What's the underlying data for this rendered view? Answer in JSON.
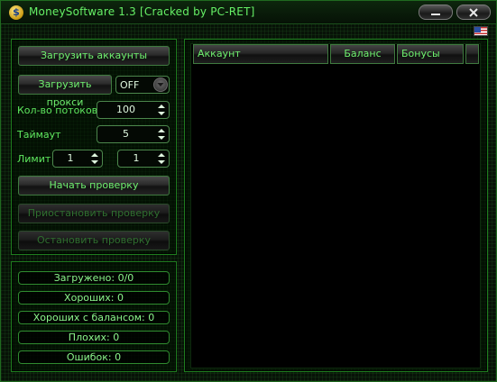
{
  "window": {
    "title": "MoneySoftware 1.3 [Cracked by PC-RET]",
    "app_icon_letter": "$",
    "accent": "#5fe85f",
    "flag": "us-flag-icon"
  },
  "controls": {
    "load_accounts": "Загрузить аккаунты",
    "load_proxy": "Загрузить прокси",
    "proxy_mode": "OFF",
    "threads_label": "Кол-во потоков",
    "threads_value": "100",
    "timeout_label": "Таймаут",
    "timeout_value": "5",
    "limit_label": "Лимит",
    "limit_from": "1",
    "limit_to": "1",
    "start_check": "Начать проверку",
    "pause_check": "Приостановить проверку",
    "stop_check": "Остановить проверку"
  },
  "stats": {
    "loaded": "Загружено: 0/0",
    "good": "Хороших: 0",
    "good_balance": "Хороших с балансом: 0",
    "bad": "Плохих: 0",
    "errors": "Ошибок: 0"
  },
  "table": {
    "columns": [
      "Аккаунт",
      "Баланс",
      "Бонусы"
    ],
    "rows": []
  }
}
